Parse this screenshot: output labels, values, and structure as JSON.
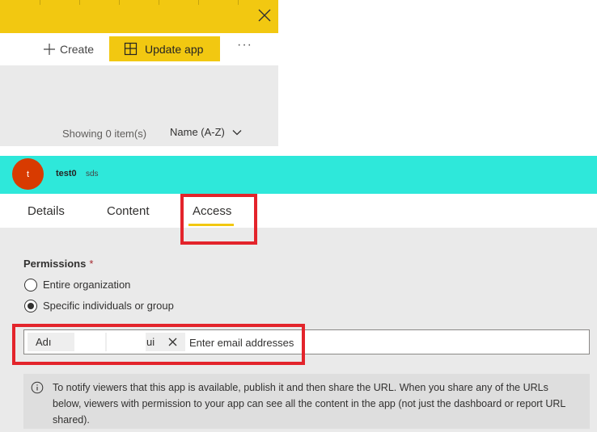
{
  "toolbar": {
    "create_label": "Create",
    "update_label": "Update app",
    "more_label": "···"
  },
  "list": {
    "showing_text": "Showing 0 item(s)",
    "sort_label": "Name (A-Z)"
  },
  "app": {
    "avatar_letter": "t",
    "name": "test0",
    "description": "sds"
  },
  "tabs": [
    {
      "label": "Details"
    },
    {
      "label": "Content"
    },
    {
      "label": "Access"
    }
  ],
  "access": {
    "permissions_label": "Permissions",
    "required_mark": "*",
    "options": [
      {
        "label": "Entire organization",
        "checked": false
      },
      {
        "label": "Specific individuals or group",
        "checked": true
      }
    ],
    "chip_text_start": "Adı",
    "chip_text_end": "ui",
    "email_placeholder": "Enter email addresses",
    "notice": "To notify viewers that this app is available, publish it and then share the URL. When you share any of the URLs below, viewers with permission to your app can see all the content in the app (not just the dashboard or report URL shared)."
  },
  "colors": {
    "accent": "#f2c811",
    "app_banner": "#2ee8da",
    "avatar": "#d83b01",
    "highlight": "#e3242b"
  },
  "icons": [
    "close-icon",
    "plus-icon",
    "app-layout-icon",
    "more-icon",
    "chevron-down-icon",
    "info-icon",
    "remove-chip-icon"
  ]
}
